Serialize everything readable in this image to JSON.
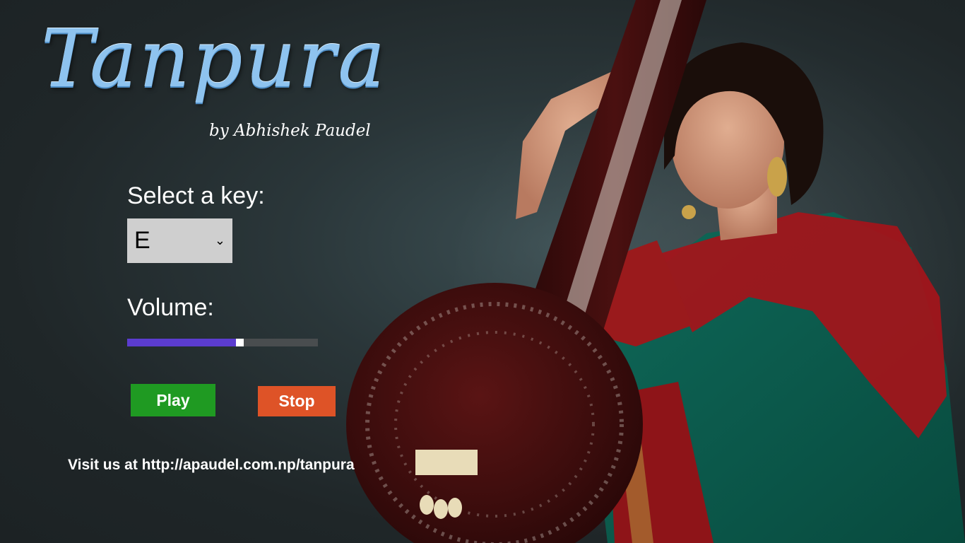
{
  "app": {
    "title": "Tanpura",
    "subtitle": "by Abhishek Paudel"
  },
  "key_select": {
    "label": "Select a key:",
    "value": "E"
  },
  "volume": {
    "label": "Volume:",
    "level": 0.59
  },
  "buttons": {
    "play_label": "Play",
    "stop_label": "Stop"
  },
  "footer": {
    "visit_text": "Visit us at http://apaudel.com.np/tanpura"
  },
  "colors": {
    "play": "#1f9a22",
    "stop": "#de5327",
    "volume_fill": "#5b3ccf",
    "title": "#8ec3ef"
  }
}
